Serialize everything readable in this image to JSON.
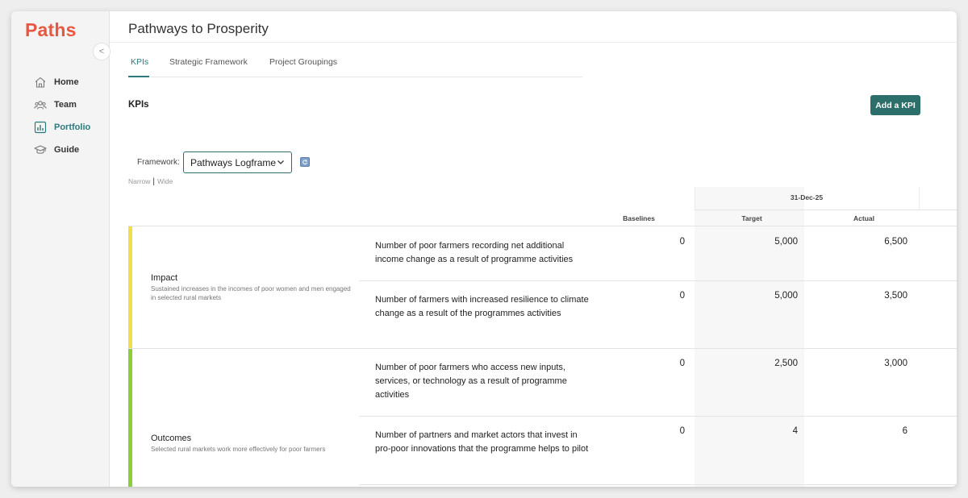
{
  "app": {
    "logo": "Paths",
    "collapse_label": "<"
  },
  "sidebar": {
    "items": [
      {
        "label": "Home",
        "icon": "home-icon",
        "active": false
      },
      {
        "label": "Team",
        "icon": "team-icon",
        "active": false
      },
      {
        "label": "Portfolio",
        "icon": "portfolio-chart-icon",
        "active": true
      },
      {
        "label": "Guide",
        "icon": "graduation-cap-icon",
        "active": false
      }
    ]
  },
  "page": {
    "title": "Pathways to Prosperity",
    "tabs": [
      {
        "label": "KPIs",
        "active": true
      },
      {
        "label": "Strategic Framework",
        "active": false
      },
      {
        "label": "Project Groupings",
        "active": false
      }
    ],
    "section_title": "KPIs",
    "add_button": "Add a KPI"
  },
  "framework": {
    "label": "Framework:",
    "selected": "Pathways Logframe",
    "width_options": [
      "Narrow",
      "Wide"
    ]
  },
  "table": {
    "period": "31-Dec-25",
    "columns": {
      "baselines": "Baselines",
      "target": "Target",
      "actual": "Actual"
    },
    "groups": [
      {
        "name": "Impact",
        "description": "Sustained increases in the incomes of poor women and men engaged in selected rural markets",
        "color": "#f2de4a",
        "kpis": [
          {
            "text": "Number of poor farmers recording net additional income change as a result of programme activities",
            "baseline": "0",
            "target": "5,000",
            "actual": "6,500"
          },
          {
            "text": "Number of farmers with increased resilience to climate change as a result of the programmes activities",
            "baseline": "0",
            "target": "5,000",
            "actual": "3,500"
          }
        ]
      },
      {
        "name": "Outcomes",
        "description": "Selected rural markets work more effectively for poor farmers",
        "color": "#8ccf3a",
        "kpis": [
          {
            "text": "Number of poor farmers who access new inputs, services, or technology as a result of programme activities",
            "baseline": "0",
            "target": "2,500",
            "actual": "3,000"
          },
          {
            "text": "Number of partners and market actors that invest in pro-poor innovations that the programme helps to pilot",
            "baseline": "0",
            "target": "4",
            "actual": "6"
          }
        ]
      }
    ]
  },
  "colors": {
    "accent": "#2c6e6a",
    "logo": "#e8573f"
  }
}
